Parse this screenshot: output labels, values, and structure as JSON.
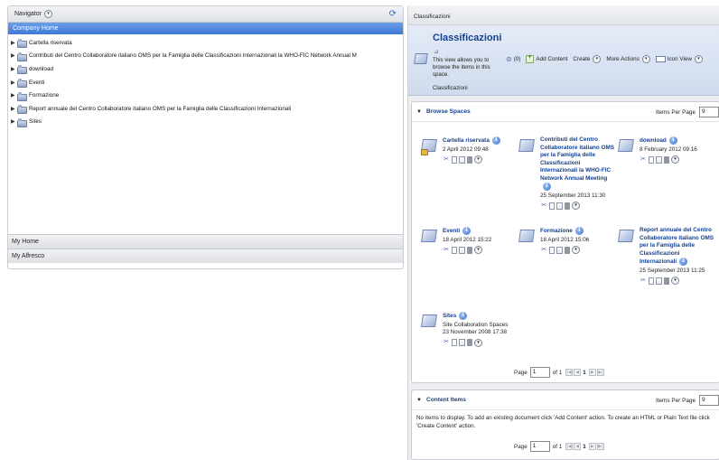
{
  "navigator": {
    "title": "Navigator",
    "menu_glyph": "▾",
    "refresh_glyph": "⟳",
    "company_home": "Company Home",
    "tree": [
      {
        "label": "Cartella riservata"
      },
      {
        "label": "Contributi del Centro Collaboratore italiano OMS per la Famiglia delle Classificazioni Internazionali la WHO-FIC Network Annual M"
      },
      {
        "label": "download"
      },
      {
        "label": "Eventi"
      },
      {
        "label": "Formazione"
      },
      {
        "label": "Report annuale del Centro Collaboratore italiano OMS per la Famiglia delle Classificazioni Internazionali"
      },
      {
        "label": "Sites"
      }
    ],
    "tree_expander": "▶",
    "my_home": "My Home",
    "my_alfresco": "My Alfresco"
  },
  "main": {
    "breadcrumb": "Classificazioni",
    "space_title": "Classificazioni",
    "space_description": "This view allows you to browse the items in this space.",
    "space_name": "Classificazioni",
    "toolbar": {
      "clipboard_count": "(0)",
      "add_content": "Add Content",
      "create": "Create",
      "more_actions": "More Actions",
      "icon_view": "Icon View"
    },
    "browse": {
      "title": "Browse Spaces",
      "items_per_page_label": "Items Per Page",
      "items_per_page_value": "9",
      "spaces": [
        {
          "name": "Cartella riservata",
          "meta1": "2 April 2012 09:48",
          "meta2": ""
        },
        {
          "name": "Contributi del Centro Collaboratore italiano OMS per la Famiglia delle Classificazioni Internazionali la WHO-FIC Network Annual Meeting",
          "meta1": "25 September 2013 11:30",
          "meta2": ""
        },
        {
          "name": "download",
          "meta1": "8 February 2012 09:16",
          "meta2": ""
        },
        {
          "name": "Eventi",
          "meta1": "18 April 2012 15:22",
          "meta2": ""
        },
        {
          "name": "Formazione",
          "meta1": "18 April 2012 15:06",
          "meta2": ""
        },
        {
          "name": "Report annuale del Centro Collaboratore italiano OMS per la Famiglia delle Classificazioni Internazionali",
          "meta1": "25 September 2013 11:25",
          "meta2": ""
        },
        {
          "name": "Sites",
          "meta1": "Site Collaboration Spaces",
          "meta2": "23 November 2008 17:38"
        }
      ],
      "pager": {
        "label": "Page",
        "value": "1",
        "of": "of 1",
        "current": "1"
      }
    },
    "content": {
      "title": "Content Items",
      "items_per_page_label": "Items Per Page",
      "items_per_page_value": "9",
      "empty_message": "No items to display. To add an existing document click 'Add Content' action. To create an HTML or Plain Text file click 'Create Content' action.",
      "pager": {
        "label": "Page",
        "value": "1",
        "of": "of 1",
        "current": "1"
      }
    },
    "info_glyph": "i",
    "action_icons": [
      "cut-icon",
      "copy-icon",
      "properties-icon",
      "delete-icon",
      "more-actions-icon"
    ]
  },
  "colors": {
    "accent": "#3e78d6",
    "title_blue": "#15408f",
    "header_bg": "#d4dff0"
  }
}
